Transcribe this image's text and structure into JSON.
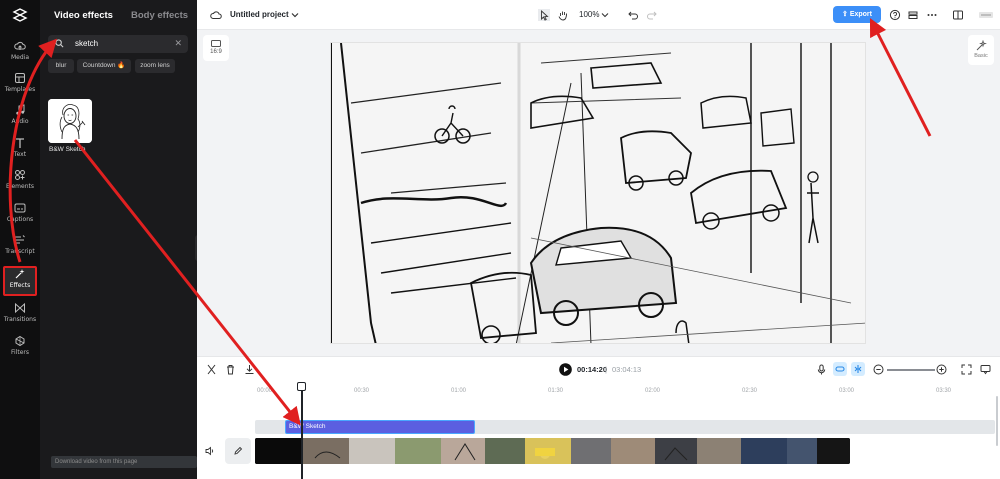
{
  "sidebar": {
    "items": [
      {
        "label": "Media",
        "icon": "cloud-upload-icon"
      },
      {
        "label": "Templates",
        "icon": "templates-icon"
      },
      {
        "label": "Audio",
        "icon": "music-note-icon"
      },
      {
        "label": "Text",
        "icon": "text-icon"
      },
      {
        "label": "Elements",
        "icon": "elements-icon"
      },
      {
        "label": "Captions",
        "icon": "captions-icon"
      },
      {
        "label": "Transcript",
        "icon": "transcript-icon"
      },
      {
        "label": "Effects",
        "icon": "effects-icon",
        "active": true
      },
      {
        "label": "Transitions",
        "icon": "transitions-icon"
      },
      {
        "label": "Filters",
        "icon": "filters-icon"
      }
    ]
  },
  "panel": {
    "tabs": [
      {
        "label": "Video effects",
        "active": true
      },
      {
        "label": "Body effects",
        "active": false
      }
    ],
    "search": {
      "value": "sketch",
      "placeholder": "Search"
    },
    "chips": [
      "blur",
      "Countdown 🔥",
      "zoom lens"
    ],
    "results": [
      {
        "label": "B&W Sketch"
      }
    ],
    "download_note": "Download video from this page"
  },
  "topbar": {
    "project_title": "Untitled project",
    "zoom": "100%",
    "export_label": "Export"
  },
  "stage": {
    "ratio_label": "16:9",
    "basic_label": "Basic"
  },
  "playback": {
    "current_time": "00:14:20",
    "separator": "|",
    "total_time": "03:04:13"
  },
  "timeline": {
    "ticks": [
      "00:00",
      "00:30",
      "01:00",
      "01:30",
      "02:00",
      "02:30",
      "03:00",
      "03:30"
    ],
    "effect_clip_label": "B&W Sketch"
  },
  "colors": {
    "accent": "#3c8ff8",
    "effect_clip": "#5b5fe0",
    "annotation": "#e02020"
  }
}
